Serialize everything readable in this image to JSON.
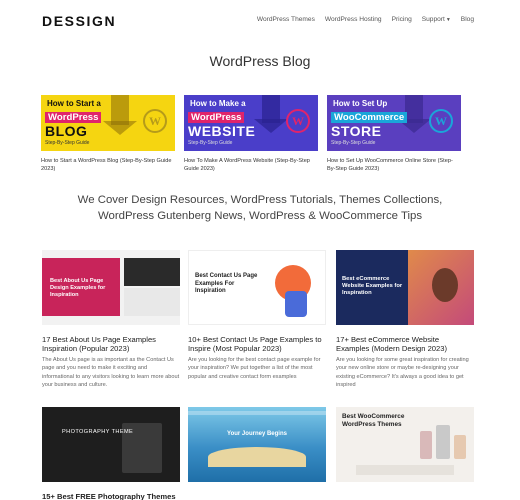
{
  "header": {
    "logo": "DESSIGN",
    "nav": [
      "WordPress Themes",
      "WordPress Hosting",
      "Pricing",
      "Support",
      "Blog"
    ]
  },
  "page_title": "WordPress Blog",
  "featured": [
    {
      "line1": "How to Start a",
      "line2": "WordPress",
      "line3": "BLOG",
      "line4": "Step-By-Step Guide",
      "caption": "How to Start a WordPress Blog (Step-By-Step Guide 2023)"
    },
    {
      "line1": "How to Make a",
      "line2": "WordPress",
      "line3": "WEBSITE",
      "line4": "Step-By-Step Guide",
      "caption": "How To Make A WordPress Website (Step-By-Step Guide 2023)"
    },
    {
      "line1": "How to Set Up",
      "line2": "WooCommerce",
      "line3": "STORE",
      "line4": "Step-By-Step Guide",
      "caption": "How to Set Up WooCommerce Online Store (Step-By-Step Guide 2023)"
    }
  ],
  "tagline": "We Cover Design Resources, WordPress Tutorials, Themes Collections, WordPress Gutenberg News, WordPress & WooCommerce Tips",
  "articles": [
    {
      "img_text": "Best About Us Page Design Examples for Inspiration",
      "title": "17 Best About Us Page Examples Inspiration (Popular 2023)",
      "excerpt": "The About Us page is as important as the Contact Us page and you need to make it exciting and informational to any visitors looking to learn more about your business and culture."
    },
    {
      "img_text": "Best Contact Us Page Examples For Inspiration",
      "title": "10+ Best Contact Us Page Examples to Inspire (Most Popular 2023)",
      "excerpt": "Are you looking for the best contact page example for your inspiration? We put together a list of the most popular and creative contact form examples"
    },
    {
      "img_text": "Best eCommerce Website Examples for Inspiration",
      "title": "17+ Best eCommerce Website Examples (Modern Design 2023)",
      "excerpt": "Are you looking for some great inspiration for creating your new online store or maybe re-designing your existing eCommerce? It's always a good idea to get inspired"
    },
    {
      "img_text": "PHOTOGRAPHY THEME",
      "title": "15+ Best FREE Photography Themes",
      "excerpt": ""
    },
    {
      "img_text": "Your Journey Begins",
      "title": "",
      "excerpt": ""
    },
    {
      "img_text": "Best WooCommerce WordPress Themes",
      "title": "",
      "excerpt": ""
    }
  ]
}
